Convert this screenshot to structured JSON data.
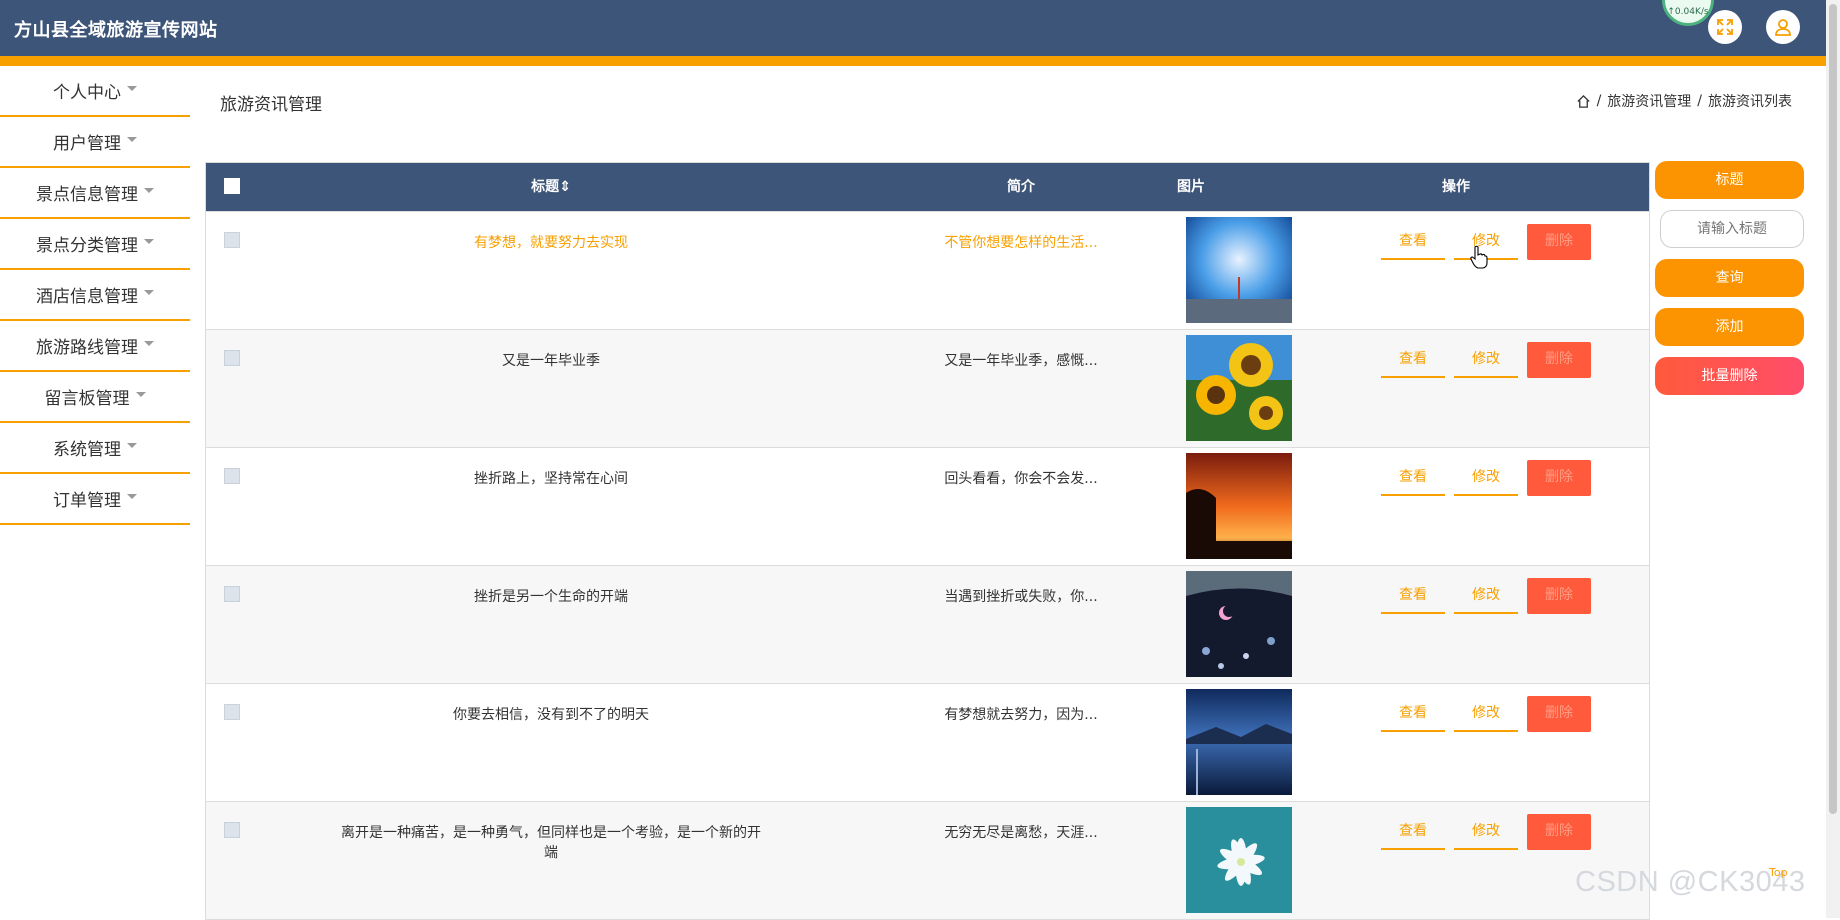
{
  "app": {
    "title": "方山县全域旅游宣传网站",
    "network_speed": "↑0.04K/s"
  },
  "sidebar": {
    "items": [
      {
        "label": "个人中心"
      },
      {
        "label": "用户管理"
      },
      {
        "label": "景点信息管理"
      },
      {
        "label": "景点分类管理"
      },
      {
        "label": "酒店信息管理"
      },
      {
        "label": "旅游路线管理"
      },
      {
        "label": "留言板管理"
      },
      {
        "label": "系统管理"
      },
      {
        "label": "订单管理"
      }
    ]
  },
  "page": {
    "heading": "旅游资讯管理",
    "breadcrumb": [
      "旅游资讯管理",
      "旅游资讯列表"
    ],
    "separator": "/"
  },
  "table": {
    "headers": {
      "title": "标题",
      "sort_icon": "⇕",
      "intro": "简介",
      "image": "图片",
      "actions": "操作"
    },
    "action_labels": {
      "view": "查看",
      "edit": "修改",
      "delete": "删除"
    },
    "rows": [
      {
        "title": "有梦想，就要努力去实现",
        "intro": "不管你想要怎样的生活...",
        "image": "blue-sky-lone-figure"
      },
      {
        "title": "又是一年毕业季",
        "intro": "又是一年毕业季，感慨...",
        "image": "sunflowers"
      },
      {
        "title": "挫折路上，坚持常在心间",
        "intro": "回头看看，你会不会发...",
        "image": "orange-sunset-tree"
      },
      {
        "title": "挫折是另一个生命的开端",
        "intro": "当遇到挫折或失败，你...",
        "image": "night-moon-flowers"
      },
      {
        "title": "你要去相信，没有到不了的明天",
        "intro": "有梦想就去努力，因为...",
        "image": "blue-lake-night"
      },
      {
        "title": "离开是一种痛苦，是一种勇气，但同样也是一个考验，是一个新的开端",
        "intro": "无穷无尽是离愁，天涯...",
        "image": "white-flower-teal"
      }
    ]
  },
  "right_panel": {
    "title_button": "标题",
    "search_placeholder": "请输入标题",
    "query_button": "查询",
    "add_button": "添加",
    "batch_delete_button": "批量删除"
  },
  "footer": {
    "watermark": "CSDN @CK3043",
    "top_link": "Top"
  },
  "colors": {
    "header": "#3d5578",
    "accent": "#f7a000",
    "danger": "#ff5a3c"
  }
}
